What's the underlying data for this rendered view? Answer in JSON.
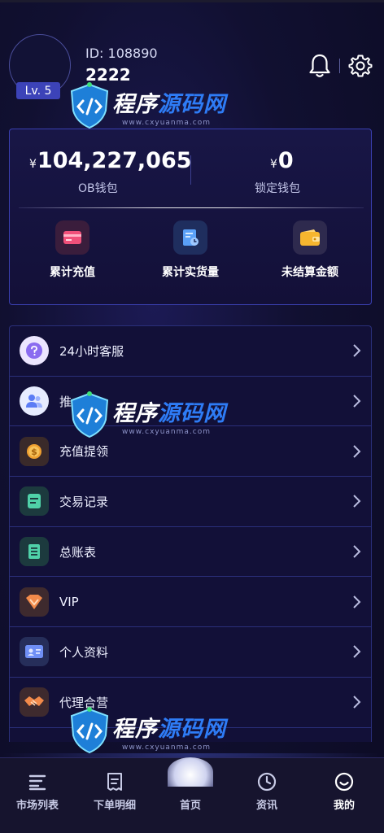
{
  "profile": {
    "id_text": "ID: 108890",
    "username": "2222",
    "level": "Lv. 5"
  },
  "wallet": {
    "ob_currency": "¥",
    "ob_amount": "104,227,065",
    "ob_label": "OB钱包",
    "locked_currency": "¥",
    "locked_amount": "0",
    "locked_label": "锁定钱包",
    "stats": [
      {
        "label": "累计充值",
        "icon": "card-icon"
      },
      {
        "label": "累计实货量",
        "icon": "report-icon"
      },
      {
        "label": "未结算金额",
        "icon": "wallet-icon"
      }
    ]
  },
  "menu": {
    "items": [
      {
        "label": "24小时客服",
        "icon": "support-icon"
      },
      {
        "label": "推",
        "icon": "team-icon"
      },
      {
        "label": "充值提领",
        "icon": "coin-icon"
      },
      {
        "label": "交易记录",
        "icon": "record-icon"
      },
      {
        "label": "总账表",
        "icon": "ledger-icon"
      },
      {
        "label": "VIP",
        "icon": "vip-icon"
      },
      {
        "label": "个人资料",
        "icon": "id-card-icon"
      },
      {
        "label": "代理合营",
        "icon": "handshake-icon"
      }
    ]
  },
  "nav": {
    "items": [
      {
        "label": "市场列表",
        "icon": "list-icon"
      },
      {
        "label": "下单明细",
        "icon": "receipt-icon"
      },
      {
        "label": "首页",
        "icon": "home-ball-icon"
      },
      {
        "label": "资讯",
        "icon": "news-icon"
      },
      {
        "label": "我的",
        "icon": "profile-icon"
      }
    ],
    "active": "我的"
  },
  "watermark": {
    "text_white": "程序",
    "text_blue": "源码网",
    "url": "www.cxyuanma.com"
  },
  "colors": {
    "accent": "#3c43b8",
    "card_border": "#3a3fb0",
    "background": "#111031"
  }
}
